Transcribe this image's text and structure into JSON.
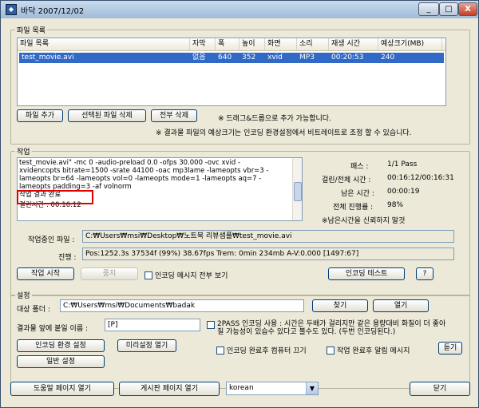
{
  "window": {
    "title": "바닥 2007/12/02",
    "min_glyph": "_",
    "max_glyph": "□",
    "close_glyph": "X"
  },
  "files": {
    "group_label": "파일 목록",
    "columns": [
      "파일 목록",
      "자막",
      "폭",
      "높이",
      "화면",
      "소리",
      "재생 시간",
      "예상크기(MB)"
    ],
    "rows": [
      [
        "test_movie.avi",
        "없음",
        "640",
        "352",
        "xvid",
        "MP3",
        "00:20:53",
        "240"
      ]
    ],
    "add_button": "파일 추가",
    "remove_selected_button": "선택된 파일 삭제",
    "remove_all_button": "전부 삭제",
    "drag_note": "※ 드래그&드롭으로 추가 가능합니다.",
    "size_note": "※ 결과물 파일의 예상크기는 인코딩 환경설정에서 비트레이트로 조정 할 수 있습니다."
  },
  "job": {
    "group_label": "작업",
    "log_lines": [
      "test_movie.avi\" -mc 0 -audio-preload 0.0 -ofps 30.000 -ovc xvid -",
      "xvidencopts bitrate=1500 -srate 44100 -oac mp3lame -lameopts vbr=3 -",
      "lameopts br=64 -lameopts vol=0 -lameopts mode=1 -lameopts aq=7 -",
      "lameopts padding=3 -af volnorm",
      "작업 결과 완료",
      "걸린시간 : 00:16:12"
    ],
    "stats": [
      {
        "label": "패스 :",
        "value": "1/1 Pass"
      },
      {
        "label": "걸린/전체 시간 :",
        "value": "00:16:12/00:16:31"
      },
      {
        "label": "남은 시간 :",
        "value": "00:00:19"
      },
      {
        "label": "전체 진행률 :",
        "value": "98%"
      }
    ],
    "trust_note": "※남은시간을 신뢰하지 말것",
    "current_file_label": "작업중인 파일 :",
    "current_file_value": "C:₩Users₩msi₩Desktop₩노트북 리뷰샘플₩test_movie.avi",
    "progress_label": "진행 :",
    "progress_value": "Pos:1252.3s  37534f (99%) 38.67fps Trem:    0min 234mb  A-V:0.000 [1497:67]",
    "start_button": "작업 시작",
    "stop_button": "중지",
    "show_all_messages": "인코딩 메시지 전부 보기",
    "encode_test_button": "인코딩 테스트",
    "help_button": "?"
  },
  "settings": {
    "group_label": "설정",
    "target_folder_label": "대상 폴더 :",
    "target_folder_value": "C:₩Users₩msi₩Documents₩badak",
    "browse_button": "찾기",
    "open_button": "열기",
    "prefix_label": "결과물 앞에 붙일 이름 :",
    "prefix_value": "[P]",
    "twopass_text": "2PASS 인코딩 사용 : 시간은 두배가 걸리지만 같은 용량대비 화질이 더 좋아질 가능성이 있습수 있다고 볼수도 있다. (두번 인코딩된다.)",
    "encode_env_button": "인코딩 환경 설정",
    "preset_button": "미리설정 열기",
    "shutdown_check": "인코딩 완료후 컴퓨터 끄기",
    "alarm_check": "작업 완료후 알림 메시지",
    "listen_button": "듣기",
    "general_button": "일반 설정"
  },
  "footer": {
    "help_page_button": "도움말 페이지 열기",
    "board_page_button": "게시판 페이지 열기",
    "language_value": "korean",
    "close_button": "닫기"
  }
}
